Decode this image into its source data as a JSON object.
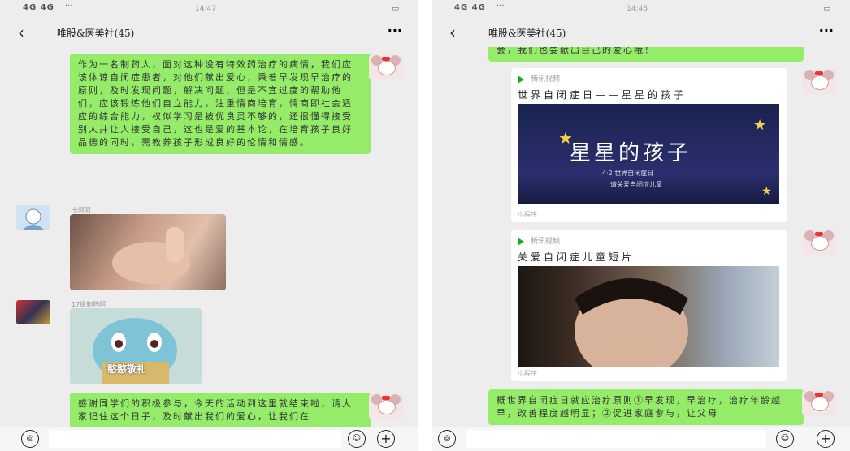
{
  "left": {
    "status": {
      "signal": "4G  4G",
      "dots": "···",
      "time": "14:47",
      "battery": "▭"
    },
    "chat_title": "唯股&医美社(45)",
    "more": "···",
    "messages": {
      "m1": "作为一名制药人，面对这种没有特效药治疗的病情，我们应该体谅自闭症患者，对他们献出爱心，秉着早发现早治疗的原则，及时发现问题，解决问题，但是不宜过度的帮助他们，应该锻炼他们自立能力，注重情商培育，情商即社会适应的综合能力，权似学习是被优良灵不够的，还很懂得接受别人并让人接受自己，这也是爱的基本论，在培育孩子良好品德的同时，需教养孩子形成良好的伦情和情感。",
      "name2": "卡阿阿",
      "name3": "17级制药阿",
      "sticker_text": "憨憨敬礼",
      "m4": "感谢同学们的积极参与，今天的活动到这里就结束啦，请大家记住这个日子，及时献出我们的爱心，让我们在"
    },
    "input": {
      "voice": "◎",
      "emoji": "☺",
      "plus": "+"
    }
  },
  "right": {
    "status": {
      "signal": "4G  4G",
      "dots": "···",
      "time": "14:48",
      "battery": "▭"
    },
    "chat_title": "唯股&医美社(45)",
    "more": "···",
    "messages": {
      "m0": "会，我们也要献出自己的爱心哦！",
      "card1": {
        "source": "腾讯视频",
        "title": "世界自闭症日——星星的孩子",
        "thumb_title": "星星的孩子",
        "thumb_sub": "4·2 世界自闭症日",
        "thumb_sub2": "请关爱自闭症儿童",
        "footer": "小程序"
      },
      "card2": {
        "source": "腾讯视频",
        "title": "关爱自闭症儿童短片",
        "footer": "小程序"
      },
      "m3": "概世界自闭症日就应治疗原则①早发现，早治疗，治疗年龄越早，改善程度越明显；②促进家庭参与，让父母"
    },
    "input": {
      "voice": "◎",
      "emoji": "☺",
      "plus": "+"
    }
  },
  "colors": {
    "bubble_green": "#95ec69",
    "bg": "#ededed"
  }
}
